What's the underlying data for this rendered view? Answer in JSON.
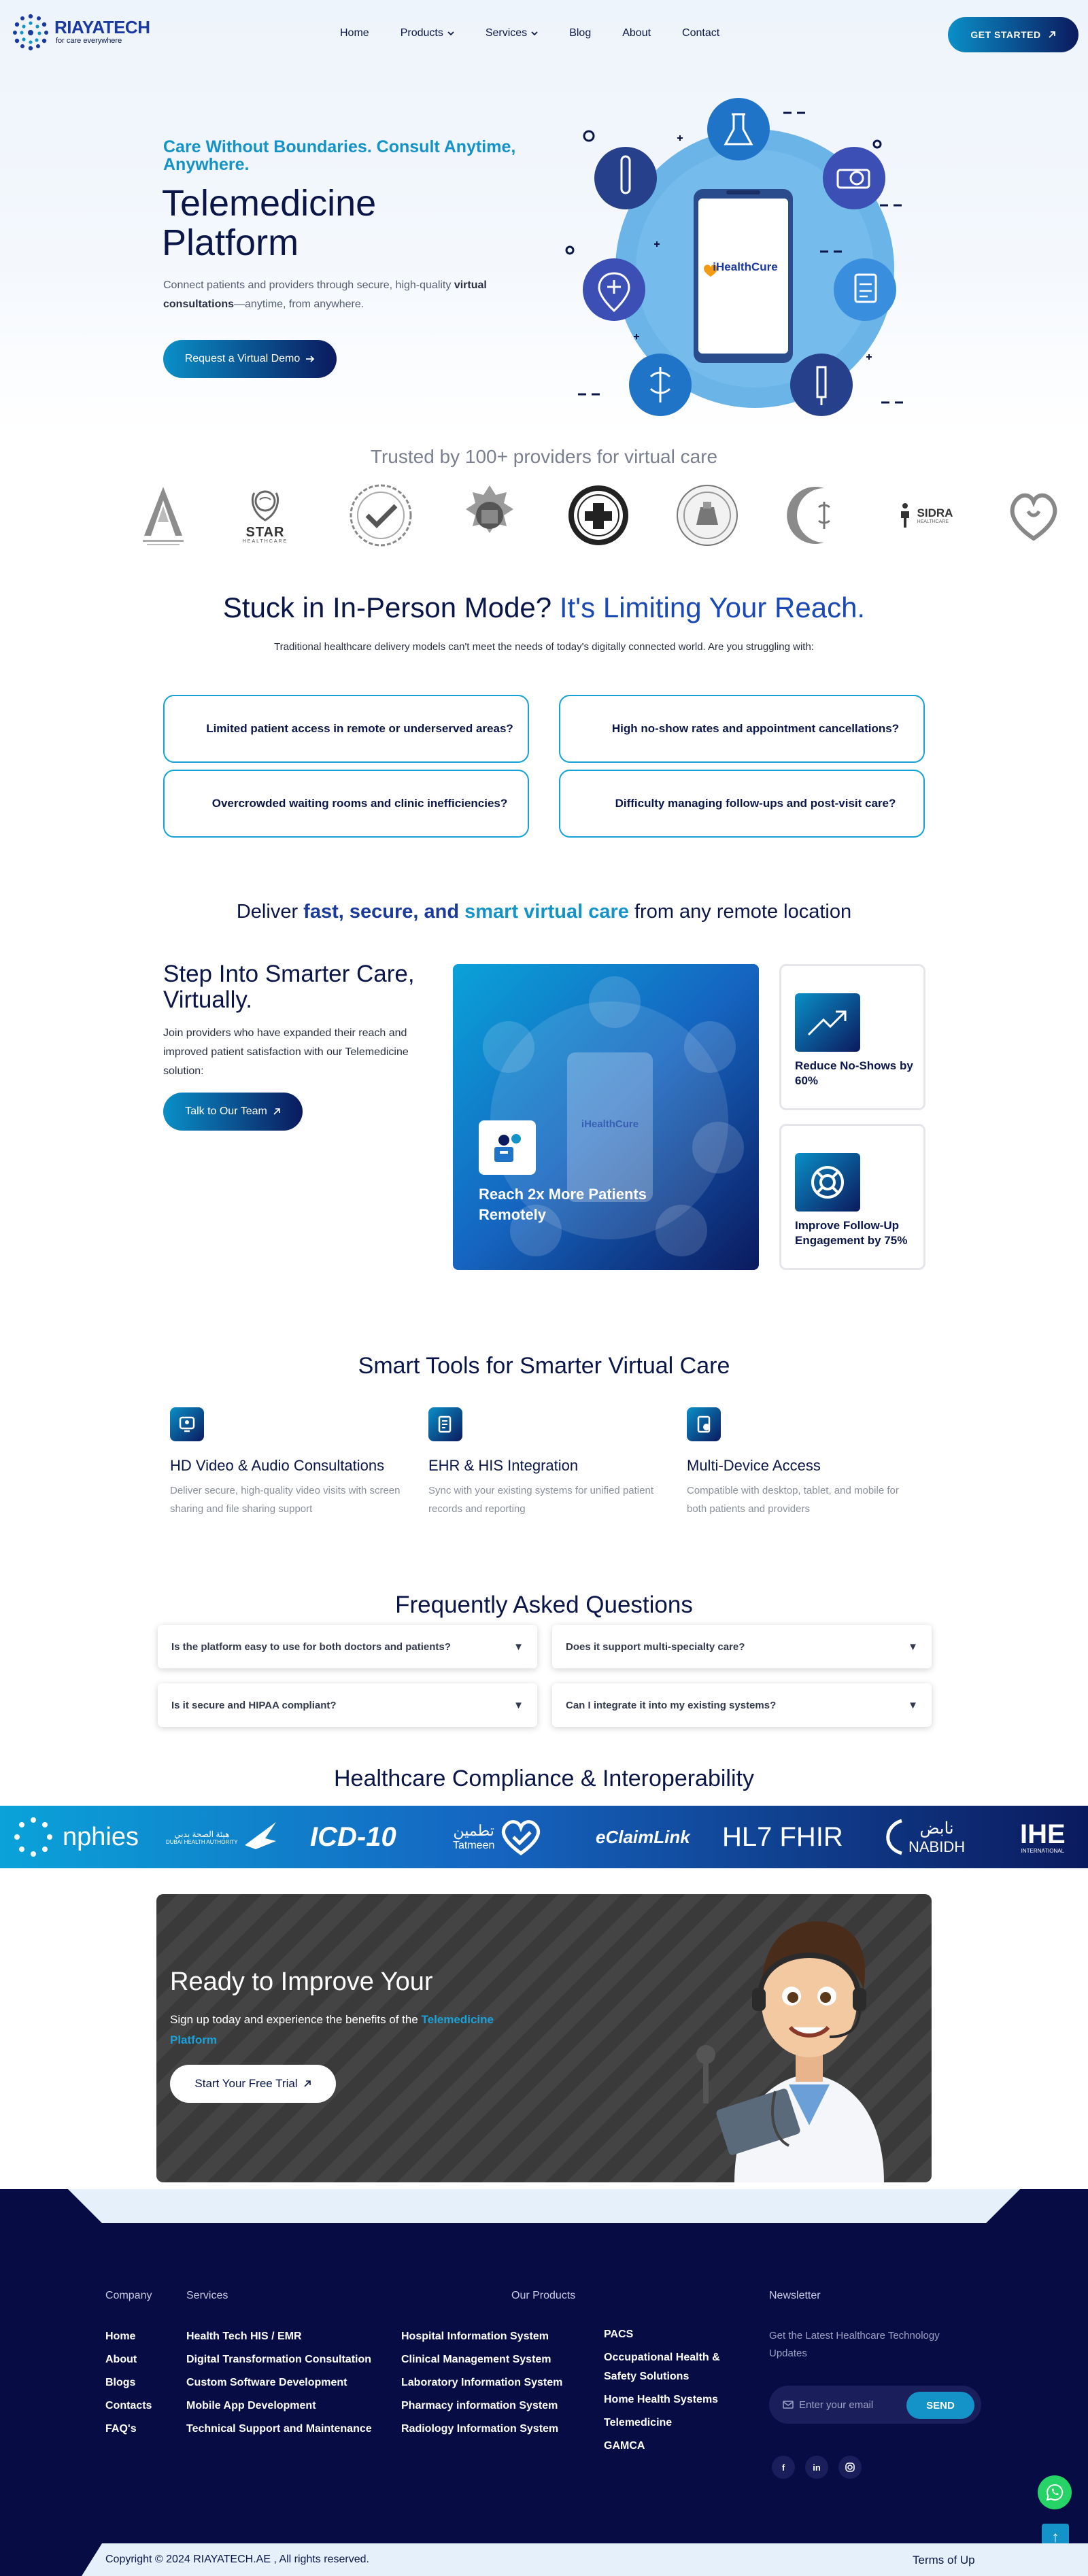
{
  "header": {
    "logo_name": "RIAYATECH",
    "logo_tagline": "for care everywhere",
    "nav": [
      "Home",
      "Products",
      "Services",
      "Blog",
      "About",
      "Contact"
    ],
    "cta": "GET STARTED"
  },
  "hero": {
    "kicker": "Care Without Boundaries. Consult Anytime, Anywhere.",
    "title": "Telemedicine Platform",
    "desc_start": "Connect patients and providers through secure, high-quality ",
    "desc_bold": "virtual consultations",
    "desc_end": "—anytime, from anywhere.",
    "button": "Request a Virtual Demo",
    "phone_brand": "iHealthCure"
  },
  "trusted": {
    "title": "Trusted by 100+ providers for virtual care",
    "logos": [
      "sha-logo",
      "star-healthcare-logo",
      "seal-logo",
      "emblem-logo",
      "medical-college-logo",
      "hospital-seal-logo",
      "crescent-logo",
      "sidra-logo",
      "care-logo"
    ],
    "star_text": "STAR",
    "star_sub": "HEALTHCARE",
    "sidra_text": "SIDRA",
    "sidra_sub": "HEALTHCARE"
  },
  "stuck": {
    "title_plain": "Stuck in In-Person Mode? ",
    "title_accent": "It's Limiting Your Reach.",
    "subtitle": "Traditional healthcare delivery models can't meet the needs of today's digitally connected world. Are you struggling with:",
    "questions": [
      "Limited patient access in remote or underserved areas?",
      "High no-show rates and appointment cancellations?",
      "Overcrowded waiting rooms and clinic inefficiencies?",
      "Difficulty managing follow-ups and post-visit care?"
    ]
  },
  "deliver": {
    "start": "Deliver ",
    "bold": "fast, secure, and ",
    "teal": "smart virtual care",
    "end": " from any remote location"
  },
  "smart": {
    "title": "Step Into Smarter Care, Virtually.",
    "desc": "Join providers who have expanded their reach and improved patient satisfaction with our Telemedicine solution:",
    "button": "Talk to Our Team",
    "big_card": "Reach 2x More Patients Remotely",
    "cards": [
      "Reduce No-Shows by 60%",
      "Improve Follow-Up Engagement by 75%"
    ]
  },
  "tools": {
    "title": "Smart Tools for Smarter Virtual Care",
    "items": [
      {
        "title": "HD Video & Audio Consultations",
        "desc": "Deliver secure, high-quality video visits with screen sharing and file sharing support"
      },
      {
        "title": "EHR & HIS Integration",
        "desc": "Sync with your existing systems for unified patient records and reporting"
      },
      {
        "title": "Multi-Device Access",
        "desc": "Compatible with desktop, tablet, and mobile for both patients and providers"
      }
    ]
  },
  "faq": {
    "title": "Frequently Asked Questions",
    "items": [
      "Is the platform easy to use for both doctors and patients?",
      "Does it support multi-specialty care?",
      "Is it secure and HIPAA compliant?",
      "Can I integrate it into my existing systems?"
    ]
  },
  "compliance": {
    "title": "Healthcare Compliance & Interoperability",
    "logos": [
      "nphies",
      "هيئة الصحة بدبي",
      "DUBAI HEALTH AUTHORITY",
      "ICD-10",
      "تطمين",
      "Tatmeen",
      "eClaimLink",
      "HL7 FHIR",
      "نابض",
      "NABIDH",
      "IHE",
      "INTERNATIONAL"
    ]
  },
  "cta": {
    "title": "Ready to Improve Your",
    "desc_start": "Sign up today and experience the benefits of the ",
    "desc_link": "Telemedicine Platform",
    "button": "Start Your Free Trial"
  },
  "footer": {
    "company_heading": "Company",
    "company_links": [
      "Home",
      "About",
      "Blogs",
      "Contacts",
      "FAQ's"
    ],
    "services_heading": "Services",
    "services_links": [
      "Health Tech HIS / EMR",
      "Digital Transformation Consultation",
      "Custom Software Development",
      "Mobile App Development",
      "Technical Support and Maintenance"
    ],
    "products_heading": "Our Products",
    "products_col1": [
      "Hospital Information System",
      "Clinical Management System",
      "Laboratory Information System",
      "Pharmacy information System",
      "Radiology Information System"
    ],
    "products_col2": [
      "PACS",
      "Occupational Health & Safety Solutions",
      "Home Health Systems",
      "Telemedicine",
      "GAMCA"
    ],
    "newsletter_heading": "Newsletter",
    "newsletter_desc": "Get the Latest Healthcare Technology Updates",
    "email_placeholder": "Enter your email",
    "send": "SEND",
    "social": [
      "facebook-icon",
      "linkedin-icon",
      "instagram-icon"
    ],
    "copyright": "Copyright © 2024 RIAYATECH.AE , All rights reserved.",
    "terms": "Terms of Up"
  },
  "colors": {
    "navy": "#0b1648",
    "teal": "#1493c9",
    "accent_blue": "#1a49b5",
    "footer_bg": "#070c45"
  }
}
